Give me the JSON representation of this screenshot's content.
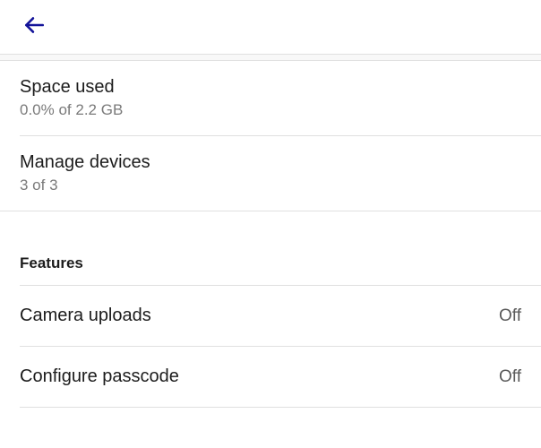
{
  "account": {
    "space_used": {
      "title": "Space used",
      "subtitle": "0.0% of 2.2 GB"
    },
    "manage_devices": {
      "title": "Manage devices",
      "subtitle": "3 of 3"
    }
  },
  "features": {
    "section_title": "Features",
    "camera_uploads": {
      "label": "Camera uploads",
      "value": "Off"
    },
    "configure_passcode": {
      "label": "Configure passcode",
      "value": "Off"
    }
  }
}
